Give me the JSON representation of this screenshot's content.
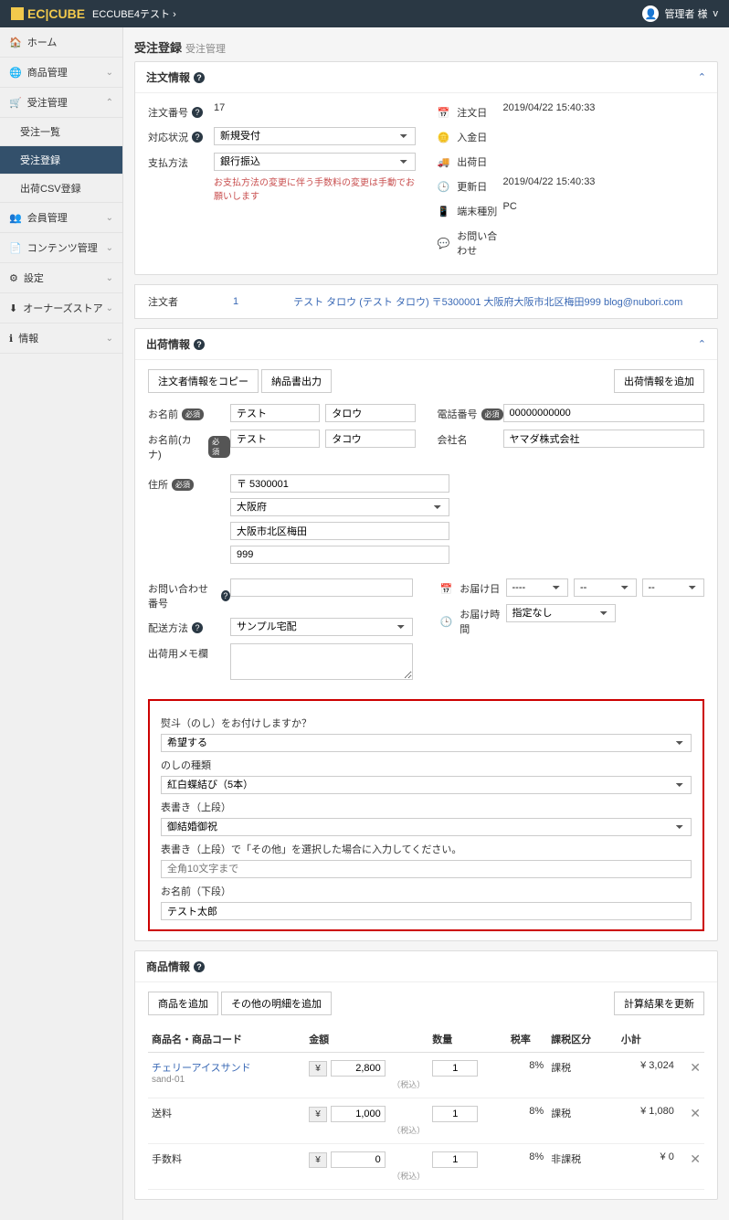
{
  "topbar": {
    "brand": "EC|CUBE",
    "crumb": "ECCUBE4テスト",
    "chev": "›",
    "user": "管理者 様",
    "userChev": "v"
  },
  "nav": {
    "home": "ホーム",
    "product": "商品管理",
    "order": "受注管理",
    "orderList": "受注一覧",
    "orderReg": "受注登録",
    "csv": "出荷CSV登録",
    "member": "会員管理",
    "content": "コンテンツ管理",
    "setting": "設定",
    "owner": "オーナーズストア",
    "info": "情報"
  },
  "page": {
    "title": "受注登録",
    "sub": "受注管理"
  },
  "orderInfo": {
    "title": "注文情報",
    "noLabel": "注文番号",
    "no": "17",
    "statusLabel": "対応状況",
    "status": "新規受付",
    "payLabel": "支払方法",
    "pay": "銀行振込",
    "payWarn": "お支払方法の変更に伴う手数料の変更は手動でお願いします",
    "dateLabel": "注文日",
    "date": "2019/04/22 15:40:33",
    "paidLabel": "入金日",
    "shipLabel": "出荷日",
    "updLabel": "更新日",
    "upd": "2019/04/22 15:40:33",
    "devLabel": "端末種別",
    "dev": "PC",
    "inqLabel": "お問い合わせ"
  },
  "purchaser": {
    "label": "注文者",
    "id": "1",
    "text": "テスト タロウ (テスト タロウ) 〒5300001 大阪府大阪市北区梅田999 blog@nubori.com"
  },
  "ship": {
    "title": "出荷情報",
    "btnCopy": "注文者情報をコピー",
    "btnMember": "納品書出力",
    "btnAdd": "出荷情報を追加",
    "nameLabel": "お名前",
    "req": "必須",
    "sei": "テスト",
    "mei": "タロウ",
    "kanaLabel": "お名前(カナ)",
    "kanaSei": "テスト",
    "kanaMei": "タコウ",
    "telLabel": "電話番号",
    "tel": "00000000000",
    "coLabel": "会社名",
    "co": "ヤマダ株式会社",
    "addrLabel": "住所",
    "zip": "〒 5300001",
    "pref": "大阪府",
    "addr1": "大阪市北区梅田",
    "addr2": "999",
    "inqLabel": "お問い合わせ番号",
    "prefDateLabel": "お届け日",
    "prefTimeLabel": "お届け時間",
    "prefTime": "指定なし",
    "delivLabel": "配送方法",
    "deliv": "サンプル宅配",
    "memoLabel": "出荷用メモ欄"
  },
  "noshi": {
    "q": "熨斗（のし）をお付けしますか？",
    "a1": "希望する",
    "kindLabel": "のしの種類",
    "kind": "紅白蝶結び（5本）",
    "upLabel": "表書き（上段）",
    "up": "御結婚御祝",
    "upOtherLabel": "表書き（上段）で「その他」を選択した場合に入力してください。",
    "upOtherPh": "全角10文字まで",
    "lowLabel": "お名前（下段）",
    "low": "テスト太郎"
  },
  "products": {
    "title": "商品情報",
    "btnAdd": "商品を追加",
    "btnAddOther": "その他の明細を追加",
    "btnRecalc": "計算結果を更新",
    "thName": "商品名・商品コード",
    "thPrice": "金額",
    "thQty": "数量",
    "thTax": "税率",
    "thTaxType": "課税区分",
    "thSub": "小計",
    "rows": [
      {
        "name": "チェリーアイスサンド",
        "code": "sand-01",
        "price": "2,800",
        "qty": "1",
        "taxRate": "8%",
        "taxType": "課税",
        "sub": "¥ 3,024",
        "taxNote": "（税込）"
      },
      {
        "name": "送料",
        "code": "",
        "price": "1,000",
        "qty": "1",
        "taxRate": "8%",
        "taxType": "課税",
        "sub": "¥ 1,080",
        "taxNote": "（税込）"
      },
      {
        "name": "手数料",
        "code": "",
        "price": "0",
        "qty": "1",
        "taxRate": "8%",
        "taxType": "非課税",
        "sub": "¥ 0",
        "taxNote": "（税込）"
      }
    ]
  }
}
